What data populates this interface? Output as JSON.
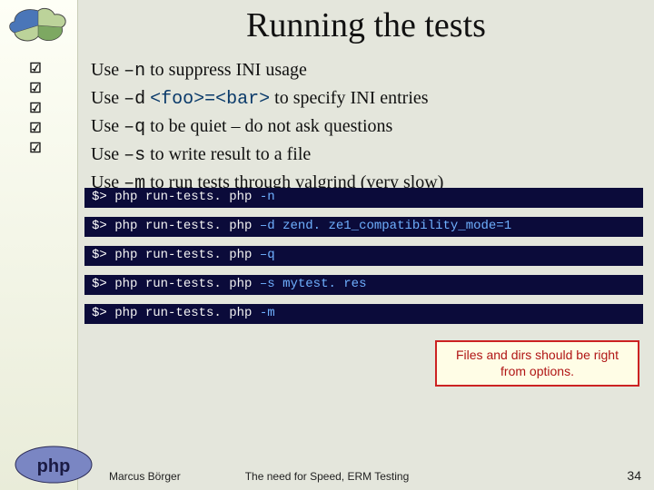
{
  "title": "Running the tests",
  "bullets": [
    {
      "prefix": "Use",
      "flag": "–n",
      "rest": "to suppress INI usage"
    },
    {
      "prefix": "Use",
      "flag": "–d",
      "arg": "<foo>=<bar>",
      "rest": "to specify INI entries"
    },
    {
      "prefix": "Use",
      "flag": "–q",
      "rest": "to be quiet – do not ask questions"
    },
    {
      "prefix": "Use",
      "flag": "–s",
      "rest": "to write result to a file"
    },
    {
      "prefix": "Use",
      "flag": "–m",
      "rest": "to run tests through valgrind (very slow)"
    }
  ],
  "check_glyph": "☑",
  "terminal": [
    {
      "prompt": "$>",
      "cmd": "php run-tests. php",
      "opt": "-n"
    },
    {
      "prompt": "$>",
      "cmd": "php run-tests. php",
      "opt": "–d zend. ze1_compatibility_mode=1"
    },
    {
      "prompt": "$>",
      "cmd": "php run-tests. php",
      "opt": "–q"
    },
    {
      "prompt": "$>",
      "cmd": "php run-tests. php",
      "opt": "–s mytest. res"
    },
    {
      "prompt": "$>",
      "cmd": "php run-tests. php",
      "opt": "-m"
    }
  ],
  "callout": "Files and dirs should be right from options.",
  "footer": {
    "author": "Marcus Börger",
    "mid": "The need for Speed, ERM Testing",
    "page": "34"
  },
  "php_logo": {
    "outer": "#7a86c3",
    "inner": "#ffffff",
    "text": "php"
  }
}
